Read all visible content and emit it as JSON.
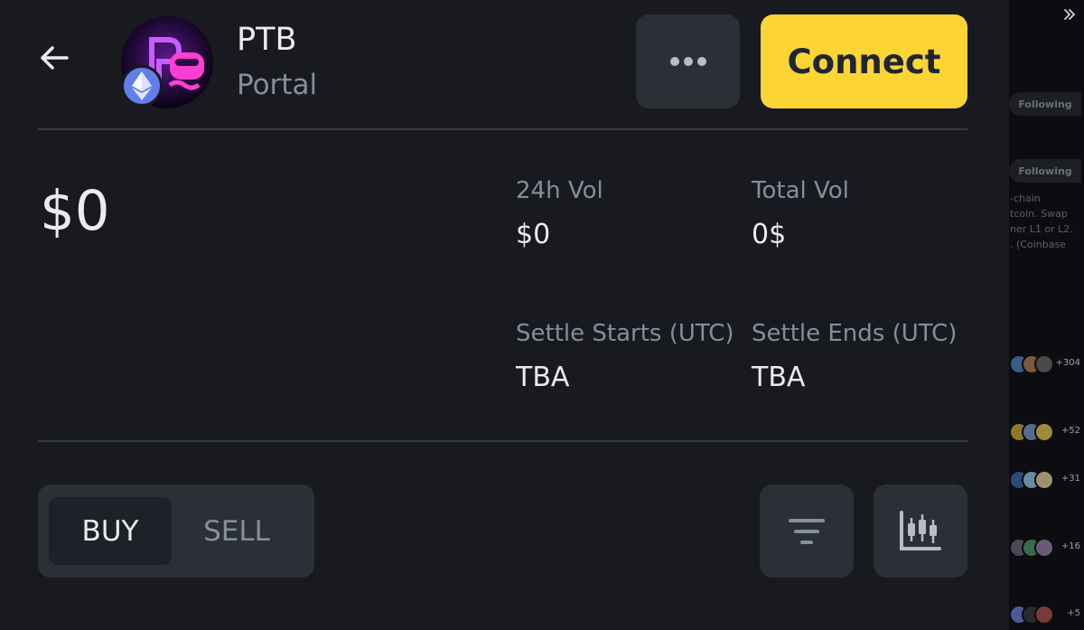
{
  "header": {
    "token_symbol": "PTB",
    "token_name": "Portal",
    "connect_label": "Connect"
  },
  "market": {
    "price": "$0",
    "vol24_label": "24h Vol",
    "vol24_value": "$0",
    "total_vol_label": "Total Vol",
    "total_vol_value": "0$",
    "settle_start_label": "Settle Starts (UTC)",
    "settle_start_value": "TBA",
    "settle_end_label": "Settle Ends (UTC)",
    "settle_end_value": "TBA"
  },
  "trade": {
    "buy_label": "BUY",
    "sell_label": "SELL",
    "active": "BUY"
  },
  "background": {
    "following_1": "Following",
    "following_2": "Following",
    "snippet_lines": [
      "-chain",
      "tcoin. Swap",
      "ner L1 or L2.",
      ". (Coinbase"
    ],
    "counts": [
      "+304",
      "+52",
      "+31",
      "+16",
      "+5"
    ]
  },
  "icons": {
    "back": "arrow-left-icon",
    "more": "ellipsis-icon",
    "filter": "filter-icon",
    "chart": "candlestick-chart-icon",
    "chain": "ethereum-icon",
    "collapse": "double-chevron-right-icon"
  },
  "colors": {
    "accent": "#fcd535",
    "background": "#181a20",
    "surface": "#2b2f36",
    "text_secondary": "#848e9c"
  }
}
